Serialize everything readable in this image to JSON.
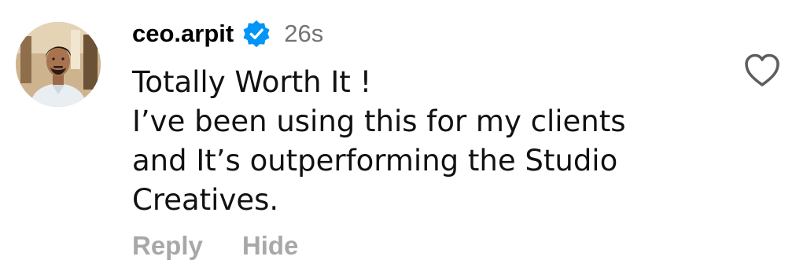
{
  "comment": {
    "username": "ceo.arpit",
    "timestamp": "26s",
    "verified": true,
    "text_lines": [
      "Totally Worth It !",
      "I’ve been using this for my clients",
      "and It’s outperforming the Studio",
      "Creatives."
    ],
    "actions": {
      "reply_label": "Reply",
      "hide_label": "Hide"
    }
  },
  "icons": {
    "verified": "verified-badge-icon",
    "like": "heart-outline-icon"
  },
  "colors": {
    "verified_badge": "#0095f6",
    "timestamp": "#737373",
    "action_text": "#a8a8a8",
    "heart_outline": "#5e5e5e"
  }
}
